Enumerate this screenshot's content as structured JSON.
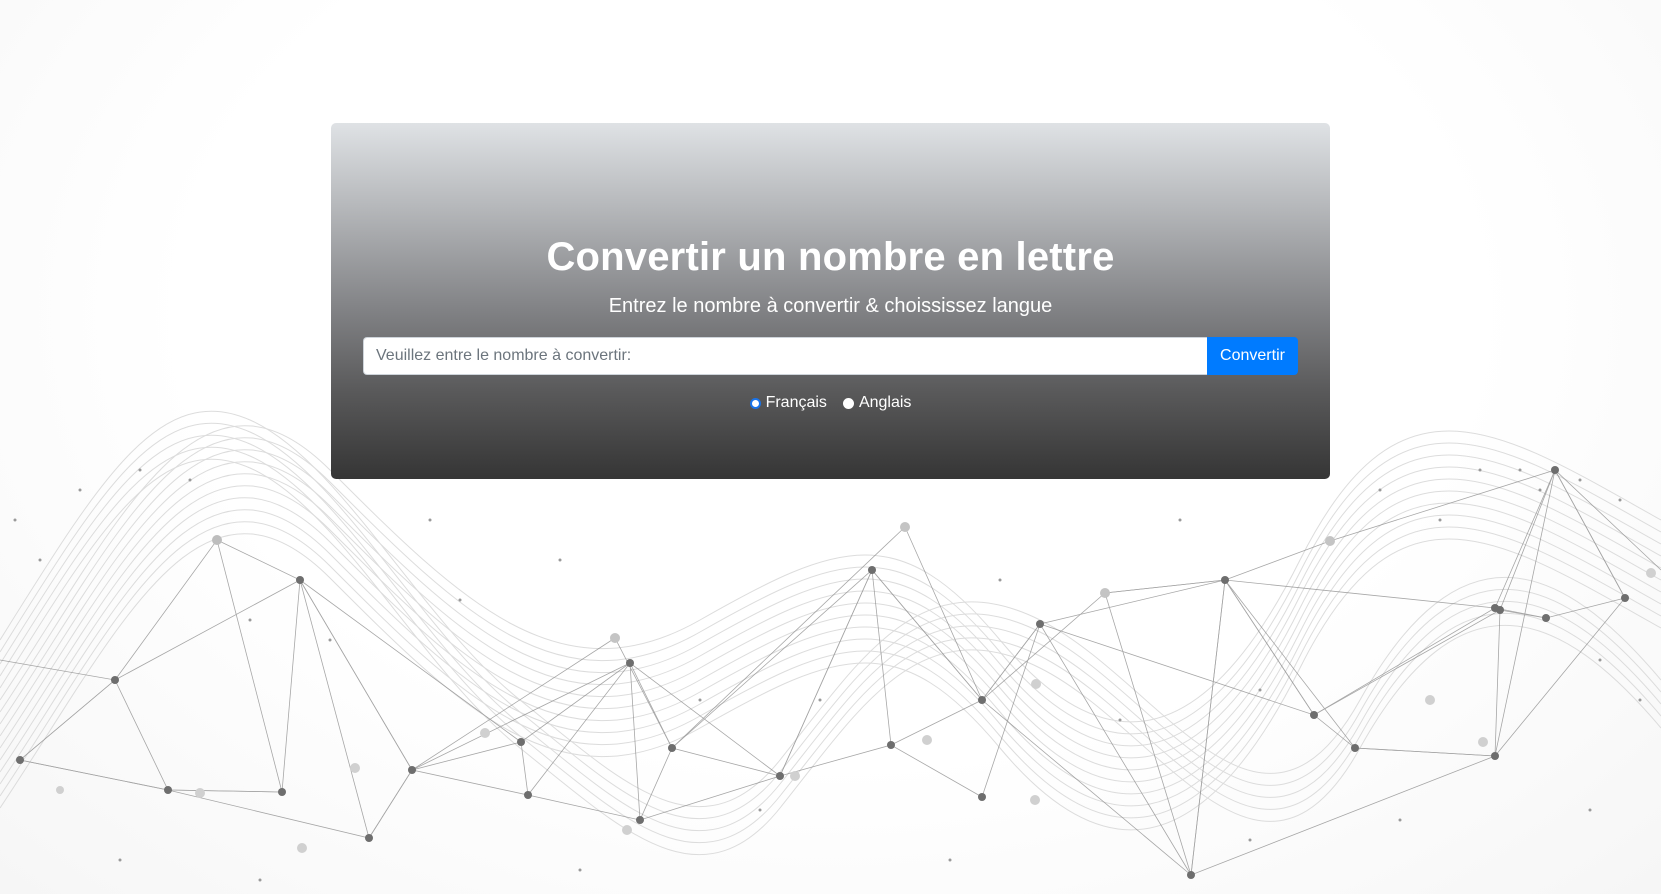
{
  "hero": {
    "title": "Convertir un nombre en lettre",
    "subtitle": "Entrez le nombre à convertir & choississez langue"
  },
  "form": {
    "input_value": "",
    "input_placeholder": "Veuillez entre le nombre à convertir:",
    "submit_label": "Convertir"
  },
  "languages": {
    "options": [
      {
        "label": "Français",
        "checked": true
      },
      {
        "label": "Anglais",
        "checked": false
      }
    ]
  },
  "colors": {
    "accent": "#007bff",
    "gradient_top": "#dfe2e5",
    "gradient_bottom": "#353535",
    "network_dark": "#6e6e6e",
    "network_light": "#cfcfcf"
  }
}
